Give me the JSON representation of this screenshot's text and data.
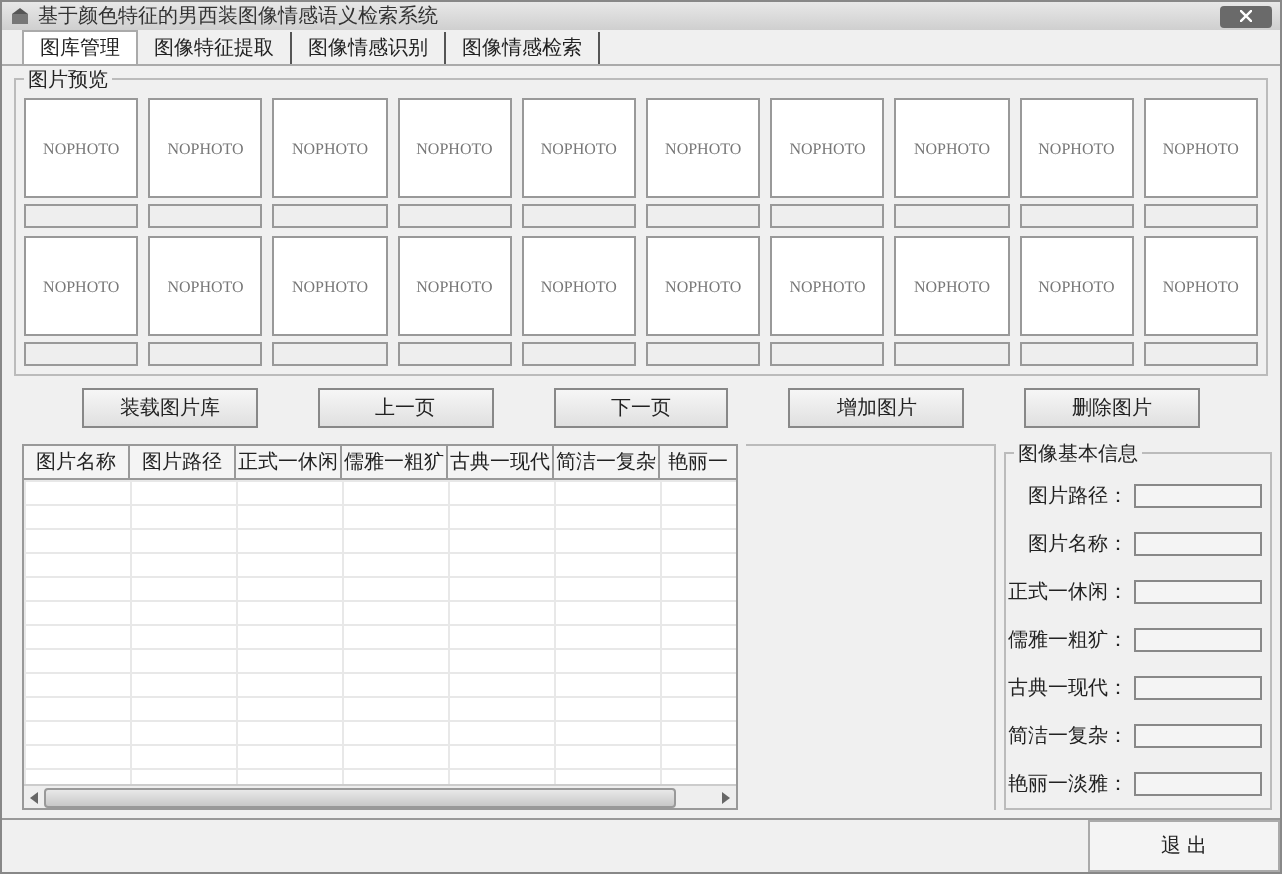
{
  "window": {
    "title": "基于颜色特征的男西装图像情感语义检索系统"
  },
  "tabs": [
    {
      "label": "图库管理",
      "selected": true
    },
    {
      "label": "图像特征提取",
      "selected": false
    },
    {
      "label": "图像情感识别",
      "selected": false
    },
    {
      "label": "图像情感检索",
      "selected": false
    }
  ],
  "preview": {
    "title": "图片预览",
    "thumbnails": [
      {
        "label": "NOPHOTO"
      },
      {
        "label": "NOPHOTO"
      },
      {
        "label": "NOPHOTO"
      },
      {
        "label": "NOPHOTO"
      },
      {
        "label": "NOPHOTO"
      },
      {
        "label": "NOPHOTO"
      },
      {
        "label": "NOPHOTO"
      },
      {
        "label": "NOPHOTO"
      },
      {
        "label": "NOPHOTO"
      },
      {
        "label": "NOPHOTO"
      },
      {
        "label": "NOPHOTO"
      },
      {
        "label": "NOPHOTO"
      },
      {
        "label": "NOPHOTO"
      },
      {
        "label": "NOPHOTO"
      },
      {
        "label": "NOPHOTO"
      },
      {
        "label": "NOPHOTO"
      },
      {
        "label": "NOPHOTO"
      },
      {
        "label": "NOPHOTO"
      },
      {
        "label": "NOPHOTO"
      },
      {
        "label": "NOPHOTO"
      }
    ]
  },
  "buttons": [
    "装载图片库",
    "上一页",
    "下一页",
    "增加图片",
    "删除图片"
  ],
  "table": {
    "columns": [
      "图片名称",
      "图片路径",
      "正式一休闲",
      "儒雅一粗犷",
      "古典一现代",
      "简洁一复杂",
      "艳丽一"
    ]
  },
  "info": {
    "title": "图像基本信息",
    "fields": [
      {
        "label": "图片路径："
      },
      {
        "label": "图片名称："
      },
      {
        "label": "正式一休闲："
      },
      {
        "label": "儒雅一粗犷："
      },
      {
        "label": "古典一现代："
      },
      {
        "label": "简洁一复杂："
      },
      {
        "label": "艳丽一淡雅："
      }
    ]
  },
  "exit_button": "退 出"
}
